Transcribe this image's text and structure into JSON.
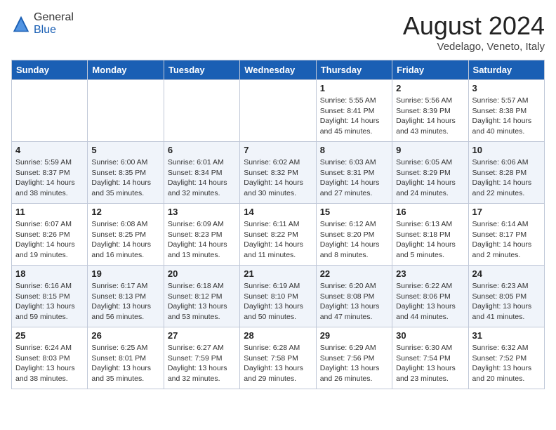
{
  "header": {
    "logo_general": "General",
    "logo_blue": "Blue",
    "month_year": "August 2024",
    "location": "Vedelago, Veneto, Italy"
  },
  "days_of_week": [
    "Sunday",
    "Monday",
    "Tuesday",
    "Wednesday",
    "Thursday",
    "Friday",
    "Saturday"
  ],
  "weeks": [
    [
      {
        "day": "",
        "info": ""
      },
      {
        "day": "",
        "info": ""
      },
      {
        "day": "",
        "info": ""
      },
      {
        "day": "",
        "info": ""
      },
      {
        "day": "1",
        "info": "Sunrise: 5:55 AM\nSunset: 8:41 PM\nDaylight: 14 hours and 45 minutes."
      },
      {
        "day": "2",
        "info": "Sunrise: 5:56 AM\nSunset: 8:39 PM\nDaylight: 14 hours and 43 minutes."
      },
      {
        "day": "3",
        "info": "Sunrise: 5:57 AM\nSunset: 8:38 PM\nDaylight: 14 hours and 40 minutes."
      }
    ],
    [
      {
        "day": "4",
        "info": "Sunrise: 5:59 AM\nSunset: 8:37 PM\nDaylight: 14 hours and 38 minutes."
      },
      {
        "day": "5",
        "info": "Sunrise: 6:00 AM\nSunset: 8:35 PM\nDaylight: 14 hours and 35 minutes."
      },
      {
        "day": "6",
        "info": "Sunrise: 6:01 AM\nSunset: 8:34 PM\nDaylight: 14 hours and 32 minutes."
      },
      {
        "day": "7",
        "info": "Sunrise: 6:02 AM\nSunset: 8:32 PM\nDaylight: 14 hours and 30 minutes."
      },
      {
        "day": "8",
        "info": "Sunrise: 6:03 AM\nSunset: 8:31 PM\nDaylight: 14 hours and 27 minutes."
      },
      {
        "day": "9",
        "info": "Sunrise: 6:05 AM\nSunset: 8:29 PM\nDaylight: 14 hours and 24 minutes."
      },
      {
        "day": "10",
        "info": "Sunrise: 6:06 AM\nSunset: 8:28 PM\nDaylight: 14 hours and 22 minutes."
      }
    ],
    [
      {
        "day": "11",
        "info": "Sunrise: 6:07 AM\nSunset: 8:26 PM\nDaylight: 14 hours and 19 minutes."
      },
      {
        "day": "12",
        "info": "Sunrise: 6:08 AM\nSunset: 8:25 PM\nDaylight: 14 hours and 16 minutes."
      },
      {
        "day": "13",
        "info": "Sunrise: 6:09 AM\nSunset: 8:23 PM\nDaylight: 14 hours and 13 minutes."
      },
      {
        "day": "14",
        "info": "Sunrise: 6:11 AM\nSunset: 8:22 PM\nDaylight: 14 hours and 11 minutes."
      },
      {
        "day": "15",
        "info": "Sunrise: 6:12 AM\nSunset: 8:20 PM\nDaylight: 14 hours and 8 minutes."
      },
      {
        "day": "16",
        "info": "Sunrise: 6:13 AM\nSunset: 8:18 PM\nDaylight: 14 hours and 5 minutes."
      },
      {
        "day": "17",
        "info": "Sunrise: 6:14 AM\nSunset: 8:17 PM\nDaylight: 14 hours and 2 minutes."
      }
    ],
    [
      {
        "day": "18",
        "info": "Sunrise: 6:16 AM\nSunset: 8:15 PM\nDaylight: 13 hours and 59 minutes."
      },
      {
        "day": "19",
        "info": "Sunrise: 6:17 AM\nSunset: 8:13 PM\nDaylight: 13 hours and 56 minutes."
      },
      {
        "day": "20",
        "info": "Sunrise: 6:18 AM\nSunset: 8:12 PM\nDaylight: 13 hours and 53 minutes."
      },
      {
        "day": "21",
        "info": "Sunrise: 6:19 AM\nSunset: 8:10 PM\nDaylight: 13 hours and 50 minutes."
      },
      {
        "day": "22",
        "info": "Sunrise: 6:20 AM\nSunset: 8:08 PM\nDaylight: 13 hours and 47 minutes."
      },
      {
        "day": "23",
        "info": "Sunrise: 6:22 AM\nSunset: 8:06 PM\nDaylight: 13 hours and 44 minutes."
      },
      {
        "day": "24",
        "info": "Sunrise: 6:23 AM\nSunset: 8:05 PM\nDaylight: 13 hours and 41 minutes."
      }
    ],
    [
      {
        "day": "25",
        "info": "Sunrise: 6:24 AM\nSunset: 8:03 PM\nDaylight: 13 hours and 38 minutes."
      },
      {
        "day": "26",
        "info": "Sunrise: 6:25 AM\nSunset: 8:01 PM\nDaylight: 13 hours and 35 minutes."
      },
      {
        "day": "27",
        "info": "Sunrise: 6:27 AM\nSunset: 7:59 PM\nDaylight: 13 hours and 32 minutes."
      },
      {
        "day": "28",
        "info": "Sunrise: 6:28 AM\nSunset: 7:58 PM\nDaylight: 13 hours and 29 minutes."
      },
      {
        "day": "29",
        "info": "Sunrise: 6:29 AM\nSunset: 7:56 PM\nDaylight: 13 hours and 26 minutes."
      },
      {
        "day": "30",
        "info": "Sunrise: 6:30 AM\nSunset: 7:54 PM\nDaylight: 13 hours and 23 minutes."
      },
      {
        "day": "31",
        "info": "Sunrise: 6:32 AM\nSunset: 7:52 PM\nDaylight: 13 hours and 20 minutes."
      }
    ]
  ]
}
